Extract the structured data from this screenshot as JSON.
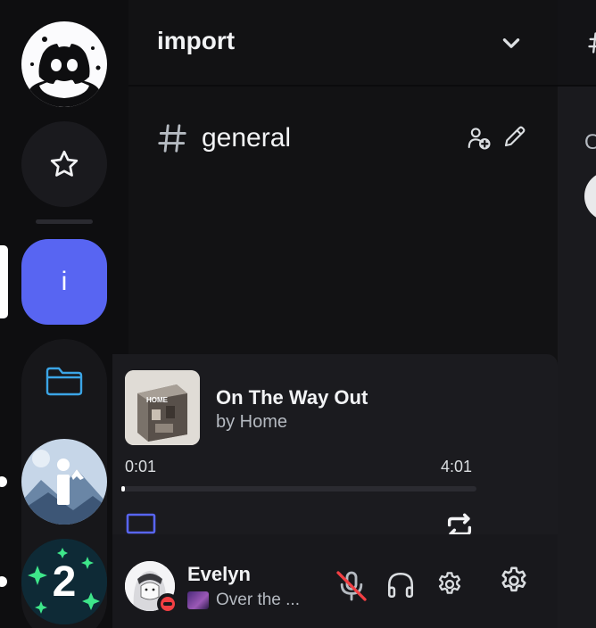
{
  "guild": {
    "name": "import",
    "channel": {
      "hash": "#",
      "name": "general"
    }
  },
  "servers": {
    "import_letter": "i",
    "second_label": "2"
  },
  "player": {
    "title": "On The Way Out",
    "artist": "by Home",
    "elapsed": "0:01",
    "duration": "4:01",
    "progress_fraction": 0.004,
    "cover_text": "HOME"
  },
  "user": {
    "name": "Evelyn",
    "status_text": "Over the ..."
  },
  "colors": {
    "accent": "#5865f2",
    "dnd": "#f23f43",
    "muted_red": "#f23f43"
  },
  "icons": {
    "home": "discord-logo-icon",
    "favorites": "star-icon",
    "folder": "folder-icon",
    "chevron": "chevron-down-icon",
    "add_member": "add-member-icon",
    "edit": "pencil-icon",
    "device": "laptop-icon",
    "repeat": "repeat-icon",
    "mic": "microphone-muted-icon",
    "headphones": "headphones-icon",
    "settings": "gear-icon"
  }
}
